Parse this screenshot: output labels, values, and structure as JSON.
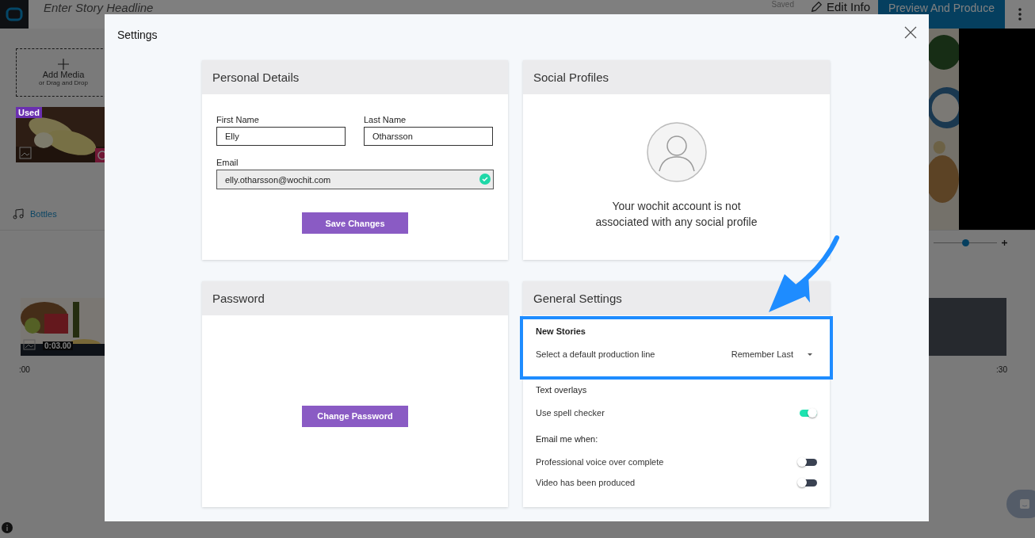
{
  "app": {
    "headline": {
      "placeholder": "Enter Story Headline"
    },
    "save_status": "Saved",
    "edit_info": "Edit Info",
    "produce_button": "Preview And Produce",
    "add_media": {
      "title": "Add Media",
      "subtitle": "or Drag and Drop"
    },
    "media_badge": "Used",
    "music_track": "Bottles",
    "zoom": {
      "level": 0.5
    },
    "timeline": {
      "clip_duration": "0:03.00",
      "start_label": ":00",
      "end_label": ":30"
    }
  },
  "dialog": {
    "title": "Settings",
    "personal_details": {
      "title": "Personal Details",
      "fields": [
        {
          "label": "First Name",
          "value": "Elly"
        },
        {
          "label": "Last Name",
          "value": "Otharsson"
        }
      ],
      "email": {
        "label": "Email",
        "value": "elly.otharsson@wochit.com",
        "verified": true
      },
      "button": "Save Changes"
    },
    "social_profiles": {
      "title": "Social Profiles",
      "message": "Your wochit account is not associated with any social profile"
    },
    "password": {
      "title": "Password",
      "button": "Change Password"
    },
    "general_settings": {
      "title": "General Settings",
      "sections": [
        {
          "heading": "New Stories",
          "highlighted": true,
          "rows": [
            {
              "kind": "select",
              "label": "Select a default production line",
              "value": "Remember Last"
            }
          ]
        },
        {
          "heading": "Text overlays",
          "highlighted": false,
          "rows": [
            {
              "kind": "toggle",
              "label": "Use spell checker",
              "on": true
            }
          ]
        },
        {
          "heading": "Email me when:",
          "highlighted": false,
          "rows": [
            {
              "kind": "toggle",
              "label": "Professional voice over complete",
              "on": false
            },
            {
              "kind": "toggle",
              "label": "Video has been produced",
              "on": false
            }
          ]
        }
      ]
    }
  }
}
